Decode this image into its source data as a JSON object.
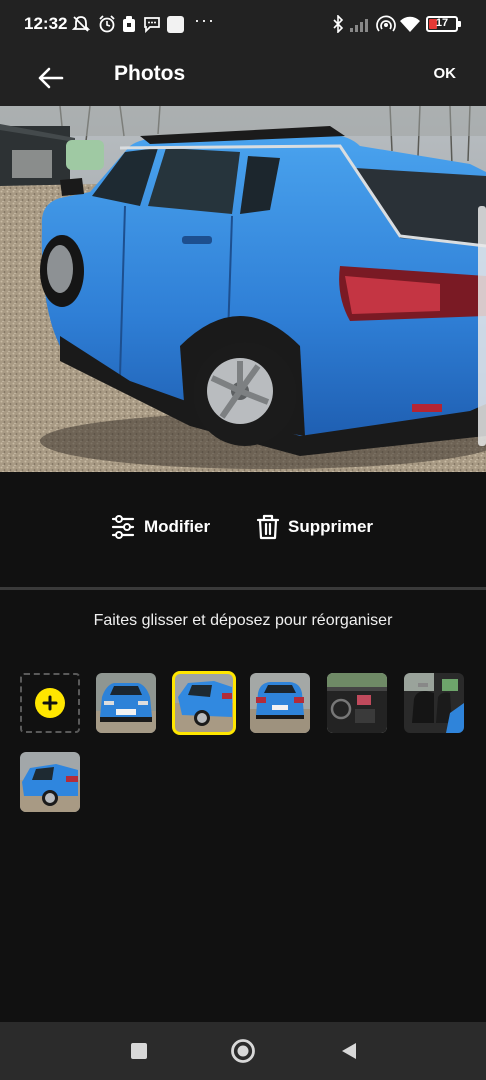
{
  "status_bar": {
    "time": "12:32",
    "battery_level": "17",
    "battery_color": "#e53935",
    "left_icons": [
      "mute-notification-icon",
      "alarm-icon",
      "task-icon",
      "message-icon",
      "app-square-icon"
    ],
    "more": "···",
    "right_icons": [
      "bluetooth-icon",
      "cell-signal-icon",
      "hotspot-icon",
      "wifi-icon",
      "battery-icon"
    ]
  },
  "header": {
    "title": "Photos",
    "ok_label": "OK",
    "back_icon": "arrow-left-icon"
  },
  "actions": {
    "edit_label": "Modifier",
    "edit_icon": "sliders-icon",
    "delete_label": "Supprimer",
    "delete_icon": "trash-icon"
  },
  "reorder_hint": "Faites glisser et déposez pour réorganiser",
  "thumbnails": {
    "add_icon": "plus-icon",
    "accent_color": "#ffe600",
    "items": [
      {
        "subject": "car-front-view",
        "selected": false
      },
      {
        "subject": "car-side-view",
        "selected": true
      },
      {
        "subject": "car-rear-view",
        "selected": false
      },
      {
        "subject": "dashboard-interior",
        "selected": false
      },
      {
        "subject": "seats-interior",
        "selected": false
      },
      {
        "subject": "car-side-view-2",
        "selected": false
      }
    ]
  },
  "nav_bar": {
    "recents_icon": "square-icon",
    "home_icon": "circle-icon",
    "back_icon": "triangle-back-icon"
  }
}
